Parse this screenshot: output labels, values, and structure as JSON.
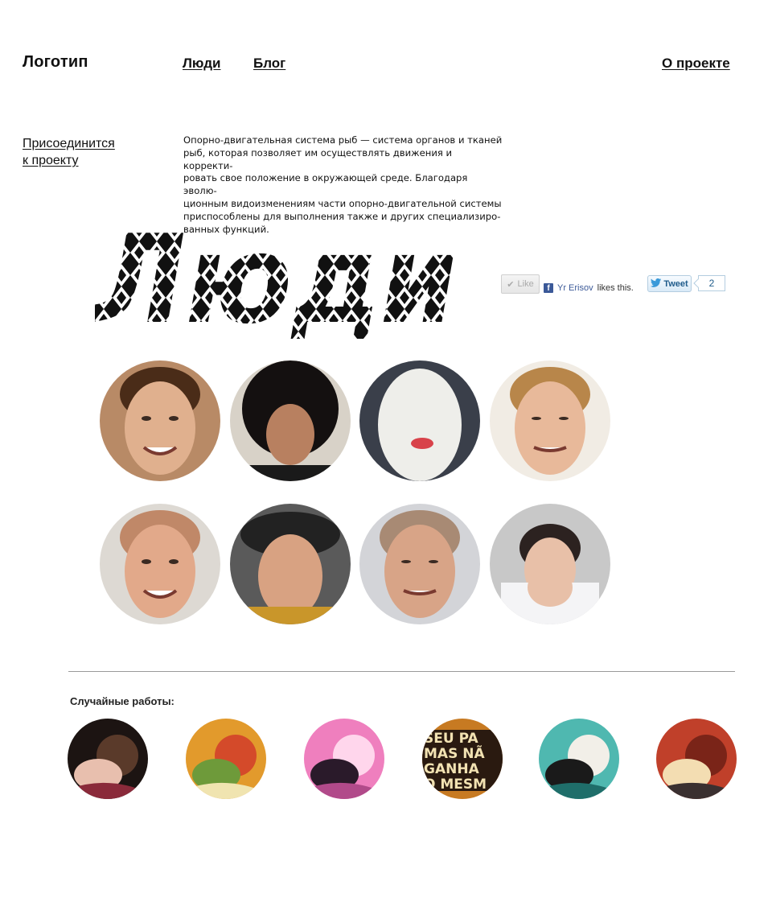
{
  "header": {
    "logo": "Логотип",
    "nav": [
      {
        "label": "Люди"
      },
      {
        "label": "Блог"
      }
    ],
    "about": "О проекте"
  },
  "join": {
    "line1": "Присоединится",
    "line2": "к проекту"
  },
  "intro": {
    "line1": "Опорно-двигательная система рыб — система органов и тканей",
    "line2": "рыб, которая позволяет им осуществлять движения и корректи-",
    "line3": "ровать свое положение в окружающей среде. Благодаря эволю-",
    "line4": "ционным видоизменениям части опорно-двигательной системы",
    "line5": "приспособлены для выполнения также и других специализиро-",
    "line6": "ванных функций."
  },
  "hero": {
    "title": "Люди",
    "pattern_colors": [
      "#111111",
      "#ffffff"
    ]
  },
  "social": {
    "like_label": "Like",
    "like_user": "Yr Erisov",
    "like_suffix": "likes this.",
    "tweet_label": "Tweet",
    "tweet_count": "2",
    "facebook_color": "#3b5998",
    "twitter_color": "#1f5c8b"
  },
  "people": [
    {
      "icon": "smiling-man-portrait",
      "bg": "#b88a66",
      "skin": "#e0b08e",
      "hair": "#4a2c18"
    },
    {
      "icon": "afro-man-portrait",
      "bg": "#d8d2c8",
      "skin": "#b88060",
      "hair": "#141010"
    },
    {
      "icon": "masked-face-portrait",
      "bg": "#3a3f4a",
      "skin": "#eeeeea",
      "hair": "#2a2a2a"
    },
    {
      "icon": "grimacing-man-portrait",
      "bg": "#f1ece4",
      "skin": "#e8b99a",
      "hair": "#b8864a"
    },
    {
      "icon": "squinting-man-portrait",
      "bg": "#ddd9d3",
      "skin": "#e2a98a",
      "hair": "#c08868"
    },
    {
      "icon": "hat-man-portrait",
      "bg": "#5a5a5a",
      "skin": "#d8a282",
      "hair": "#2b2523"
    },
    {
      "icon": "tongue-man-portrait",
      "bg": "#d3d4d8",
      "skin": "#d8a487",
      "hair": "#a88a74"
    },
    {
      "icon": "paper-cutout-portrait",
      "bg": "#c8c8c8",
      "skin": "#e8c0a8",
      "hair": "#2c2220"
    }
  ],
  "random_works": {
    "title": "Случайные работы:",
    "items": [
      {
        "icon": "painted-woman-artwork",
        "colors": [
          "#1c1412",
          "#e8bfae",
          "#5a3a2a",
          "#8a2a3a"
        ]
      },
      {
        "icon": "vegetables-painting-artwork",
        "colors": [
          "#e29a2c",
          "#6e9a3a",
          "#d44a2a",
          "#f0e4b0"
        ]
      },
      {
        "icon": "pink-3d-artwork",
        "colors": [
          "#ef7fbe",
          "#2a1a2a",
          "#ffd6ec",
          "#b14a8a"
        ]
      },
      {
        "icon": "lettering-poster-artwork",
        "colors": [
          "#c77a22",
          "#2a1a10",
          "#f2e2b2",
          "#7a3010"
        ],
        "text": [
          "SEU PA",
          "MAS NÃ",
          "GANHA",
          "O MESM"
        ]
      },
      {
        "icon": "kissing-couple-artwork",
        "colors": [
          "#4fb8b0",
          "#1a1a1a",
          "#f2efe8",
          "#1f6e6a"
        ]
      },
      {
        "icon": "comic-redhead-artwork",
        "colors": [
          "#c0402a",
          "#f3ddb2",
          "#7a2418",
          "#3a3030"
        ]
      }
    ]
  }
}
